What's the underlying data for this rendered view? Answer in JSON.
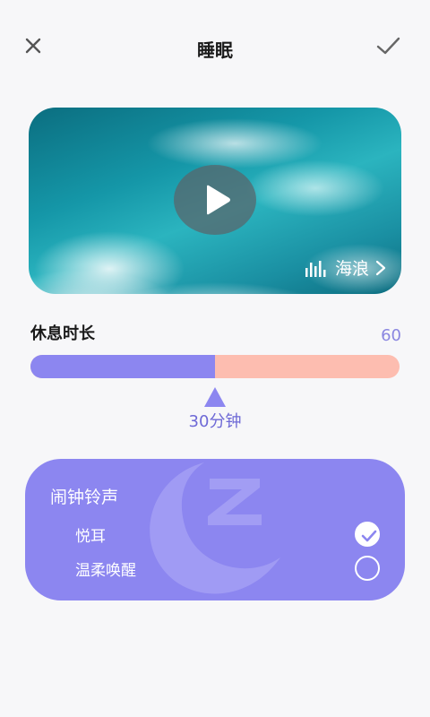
{
  "header": {
    "title": "睡眠",
    "close_icon": "close-icon",
    "confirm_icon": "check-icon"
  },
  "media": {
    "sound_name": "海浪",
    "play_icon": "play-icon",
    "wave_icon": "sound-wave-icon",
    "chevron_icon": "chevron-right-icon"
  },
  "duration": {
    "label": "休息时长",
    "max_label": "60",
    "value_label": "30分钟",
    "progress_fraction": 0.5
  },
  "alarm": {
    "title": "闹钟铃声",
    "options": [
      {
        "label": "悦耳",
        "selected": true
      },
      {
        "label": "温柔唤醒",
        "selected": false
      }
    ]
  },
  "colors": {
    "accent": "#8c86f0",
    "slider_rest": "#fdbdb0",
    "background": "#f7f7f9"
  }
}
